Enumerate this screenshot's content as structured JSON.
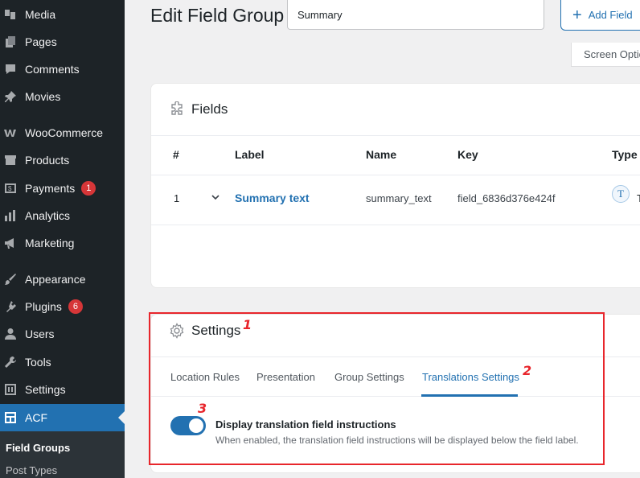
{
  "sidebar": {
    "items": [
      {
        "label": "Media",
        "icon": "media-icon"
      },
      {
        "label": "Pages",
        "icon": "pages-icon"
      },
      {
        "label": "Comments",
        "icon": "comments-icon"
      },
      {
        "label": "Movies",
        "icon": "pin-icon"
      },
      {
        "label": "WooCommerce",
        "icon": "woocommerce-icon"
      },
      {
        "label": "Products",
        "icon": "products-icon"
      },
      {
        "label": "Payments",
        "icon": "payments-icon",
        "badge": "1"
      },
      {
        "label": "Analytics",
        "icon": "analytics-icon"
      },
      {
        "label": "Marketing",
        "icon": "megaphone-icon"
      },
      {
        "label": "Appearance",
        "icon": "brush-icon"
      },
      {
        "label": "Plugins",
        "icon": "plugin-icon",
        "badge": "6"
      },
      {
        "label": "Users",
        "icon": "users-icon"
      },
      {
        "label": "Tools",
        "icon": "wrench-icon"
      },
      {
        "label": "Settings",
        "icon": "settings-icon"
      },
      {
        "label": "ACF",
        "icon": "acf-icon"
      }
    ],
    "submenu": [
      "Field Groups",
      "Post Types"
    ]
  },
  "header": {
    "title": "Edit Field Group",
    "title_value": "Summary",
    "add_field_label": "Add Field",
    "screen_options_label": "Screen Options"
  },
  "fields_panel": {
    "title": "Fields",
    "columns": [
      "#",
      "Label",
      "Name",
      "Key",
      "Type"
    ],
    "rows": [
      {
        "order": "1",
        "label": "Summary text",
        "name": "summary_text",
        "key": "field_6836d376e424f",
        "type_glyph": "T",
        "type": "Text"
      }
    ]
  },
  "settings_panel": {
    "title": "Settings",
    "tabs": [
      "Location Rules",
      "Presentation",
      "Group Settings",
      "Translations Settings"
    ],
    "active_tab": "Translations Settings",
    "toggle_label": "Display translation field instructions",
    "toggle_desc": "When enabled, the translation field instructions will be displayed below the field label.",
    "toggle_on": true
  },
  "annotations": [
    "1",
    "2",
    "3"
  ],
  "colors": {
    "sidebar_bg": "#1d2327",
    "accent": "#2271b1",
    "badge": "#d63638",
    "annotation": "#e8262c"
  }
}
